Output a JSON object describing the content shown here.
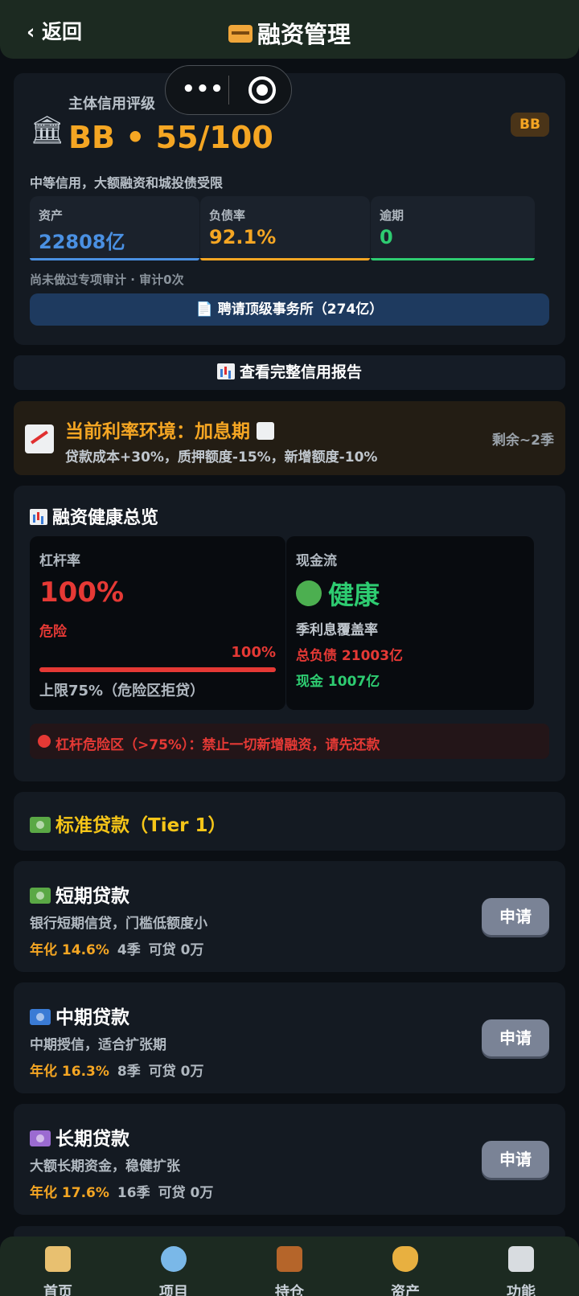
{
  "header": {
    "back_label": "‹ 返回",
    "title": "融资管理"
  },
  "credit": {
    "label": "主体信用评级",
    "grade_line": "BB • 55/100",
    "badge": "BB",
    "description": "中等信用，大额融资和城投债受限",
    "stats": [
      {
        "label": "资产",
        "value": "22808亿",
        "color": "#4a90e2"
      },
      {
        "label": "负债率",
        "value": "92.1%",
        "color": "#f5a623"
      },
      {
        "label": "逾期",
        "value": "0",
        "color": "#2ecc71"
      }
    ],
    "audit_note": "尚未做过专项审计 · 审计0次",
    "hire_button": "📄 聘请顶级事务所（274亿）"
  },
  "report_button": "查看完整信用报告",
  "rate_env": {
    "title": "当前利率环境：加息期",
    "description": "贷款成本+30%，质押额度-15%，新增额度-10%",
    "remaining": "剩余~2季"
  },
  "health": {
    "title": "融资健康总览",
    "leverage": {
      "label": "杠杆率",
      "value": "100%",
      "risk": "危险",
      "bar_pct_label": "100%",
      "fill_fraction": 1.0,
      "limit_note": "上限75%（危险区拒贷）"
    },
    "cashflow": {
      "label": "现金流",
      "status": "健康",
      "coverage_label": "季利息覆盖率",
      "total_debt": "总负债 21003亿",
      "cash": "现金 1007亿"
    },
    "warning": "杠杆危险区（>75%）：禁止一切新增融资，请先还款"
  },
  "tier1": {
    "title": "标准贷款（Tier 1）"
  },
  "loans": [
    {
      "title": "短期贷款",
      "desc": "银行短期信贷，门槛低额度小",
      "rate": "年化 14.6%",
      "term": "4季",
      "available": "可贷 0万",
      "apply": "申请",
      "icon_color": "#5aa845"
    },
    {
      "title": "中期贷款",
      "desc": "中期授信，适合扩张期",
      "rate": "年化 16.3%",
      "term": "8季",
      "available": "可贷 0万",
      "apply": "申请",
      "icon_color": "#3a7bd5"
    },
    {
      "title": "长期贷款",
      "desc": "大额长期资金，稳健扩张",
      "rate": "年化 17.6%",
      "term": "16季",
      "available": "可贷 0万",
      "apply": "申请",
      "icon_color": "#9b6bd1"
    }
  ],
  "tabs": [
    {
      "label": "首页",
      "icon": "home-icon",
      "color": "#e8c070"
    },
    {
      "label": "项目",
      "icon": "search-icon",
      "color": "#7ab8e8"
    },
    {
      "label": "持仓",
      "icon": "briefcase-icon",
      "color": "#b5652a"
    },
    {
      "label": "资产",
      "icon": "money-bag-icon",
      "color": "#e8b040"
    },
    {
      "label": "功能",
      "icon": "clipboard-icon",
      "color": "#d8dce0"
    }
  ]
}
